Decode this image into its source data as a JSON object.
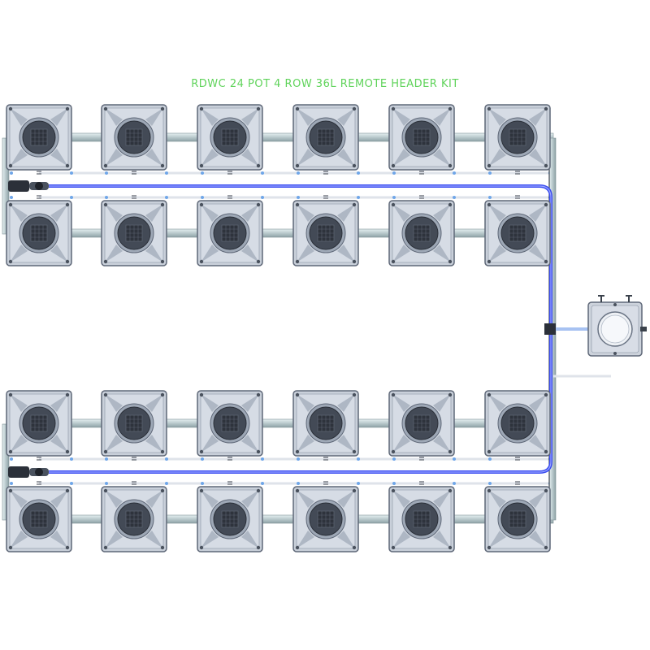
{
  "title": "RDWC 24 POT 4 ROW 36L REMOTE HEADER KIT",
  "kit": {
    "pots_total": 24,
    "rows": 4,
    "pots_per_row": 6,
    "header_tank_volume": "36L",
    "header_position": "remote"
  },
  "colors": {
    "title": "#5fd35a",
    "pot_body": "#ccd2dc",
    "pot_inner": "#dde2ea",
    "pot_edge": "#6a7484",
    "lid": "#3f4652",
    "pipe": "#b8c8cc",
    "hose": "#3a4cf0",
    "line": "#3b424c"
  },
  "icons": {
    "pot": "square-pot-icon",
    "header_tank": "header-tank-icon",
    "pump": "pump-connector-icon"
  }
}
